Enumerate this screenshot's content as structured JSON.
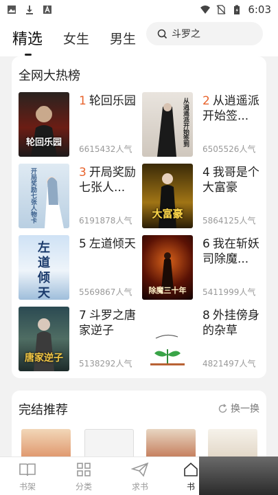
{
  "status_bar": {
    "time": "6:03"
  },
  "header": {
    "tabs": [
      {
        "label": "精选"
      },
      {
        "label": "女生"
      },
      {
        "label": "男生"
      }
    ],
    "search_value": "斗罗之"
  },
  "ranking": {
    "title": "全网大热榜",
    "books": [
      {
        "rank": "1",
        "title": "轮回乐园",
        "popularity": "6615432人气",
        "cover_text": "轮回乐园"
      },
      {
        "rank": "2",
        "title": "从逍遥派开始签...",
        "popularity": "6505526人气",
        "cover_text": "从逍遥派开始签到"
      },
      {
        "rank": "3",
        "title": "开局奖励七张人...",
        "popularity": "6191878人气",
        "cover_text": "开局奖励七张人物卡"
      },
      {
        "rank": "4",
        "title": "我哥是个大富豪",
        "popularity": "5864125人气",
        "cover_text": "大富豪"
      },
      {
        "rank": "5",
        "title": "左道倾天",
        "popularity": "5569867人气",
        "cover_text": "左道倾天"
      },
      {
        "rank": "6",
        "title": "我在斩妖司除魔...",
        "popularity": "5411999人气",
        "cover_text": "除魔三十年"
      },
      {
        "rank": "7",
        "title": "斗罗之唐家逆子",
        "popularity": "5138292人气",
        "cover_text": "唐家逆子"
      },
      {
        "rank": "8",
        "title": "外挂傍身的杂草",
        "popularity": "4821497人气",
        "cover_text": ""
      }
    ]
  },
  "finished": {
    "title": "完结推荐",
    "refresh_label": "换一换"
  },
  "bottom_nav": [
    {
      "label": "书架"
    },
    {
      "label": "分类"
    },
    {
      "label": "求书"
    },
    {
      "label": "书"
    }
  ]
}
